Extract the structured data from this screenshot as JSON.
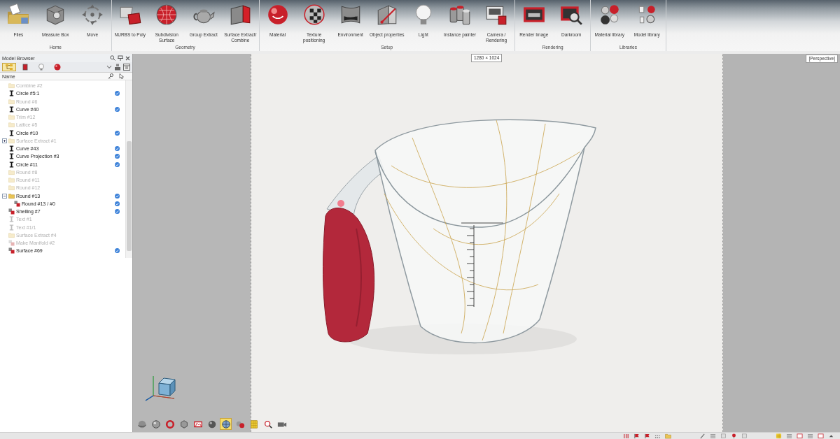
{
  "ribbon": {
    "groups": [
      {
        "label": "Home",
        "buttons": [
          {
            "label": "Files",
            "kind": "folder"
          },
          {
            "label": "Measure Box",
            "kind": "box"
          },
          {
            "label": "Move",
            "kind": "move"
          }
        ]
      },
      {
        "label": "Geometry",
        "buttons": [
          {
            "label": "NURBS to Poly",
            "kind": "sheets"
          },
          {
            "label": "Subdivision\nSurface",
            "kind": "grid_sphere"
          },
          {
            "label": "Group Extract",
            "kind": "teapot"
          },
          {
            "label": "Surface Extract/\nCombine",
            "kind": "cube"
          }
        ]
      },
      {
        "label": "Setup",
        "buttons": [
          {
            "label": "Material",
            "kind": "sphere"
          },
          {
            "label": "Texture\npositioning",
            "kind": "checker"
          },
          {
            "label": "Environment",
            "kind": "panel"
          },
          {
            "label": "Object properties",
            "kind": "box_pencil"
          },
          {
            "label": "Light",
            "kind": "bulb"
          },
          {
            "label": "Instance painter",
            "kind": "cylinders"
          },
          {
            "label": "Camera /\nRendering",
            "kind": "frames"
          }
        ]
      },
      {
        "label": "Rendering",
        "buttons": [
          {
            "label": "Render Image",
            "kind": "picture"
          },
          {
            "label": "Darkroom",
            "kind": "darkroom"
          }
        ]
      },
      {
        "label": "Libraries",
        "buttons": [
          {
            "label": "Material library",
            "kind": "spheres"
          },
          {
            "label": "Model library",
            "kind": "shapes"
          }
        ]
      }
    ]
  },
  "model_browser": {
    "title": "Model Browser",
    "tabs": [
      {
        "kind": "tree",
        "selected": true
      },
      {
        "kind": "square",
        "selected": false
      },
      {
        "kind": "bulb",
        "selected": false
      },
      {
        "kind": "sphere",
        "selected": false
      }
    ],
    "column": "Name",
    "tree": [
      {
        "label": "Combine #2",
        "kind": "folder",
        "visible": false
      },
      {
        "label": "Circle #5:1",
        "kind": "curve",
        "visible": true
      },
      {
        "label": "Round #6",
        "kind": "folder",
        "visible": false
      },
      {
        "label": "Curve #40",
        "kind": "curve",
        "visible": true
      },
      {
        "label": "Trim #12",
        "kind": "folder",
        "visible": false
      },
      {
        "label": "Lattice #5",
        "kind": "folder",
        "visible": false
      },
      {
        "label": "Circle #10",
        "kind": "curve",
        "visible": true
      },
      {
        "label": "Surface Extract #1",
        "kind": "folder",
        "visible": false,
        "expanded": false
      },
      {
        "label": "Curve #43",
        "kind": "curve",
        "visible": true
      },
      {
        "label": "Curve Projection #3",
        "kind": "curve",
        "visible": true
      },
      {
        "label": "Circle #11",
        "kind": "curve",
        "visible": true
      },
      {
        "label": "Round #8",
        "kind": "folder",
        "visible": false
      },
      {
        "label": "Round #11",
        "kind": "folder",
        "visible": false
      },
      {
        "label": "Round #12",
        "kind": "folder",
        "visible": false
      },
      {
        "label": "Round #13",
        "kind": "folder",
        "visible": true,
        "expanded": true,
        "children": [
          {
            "label": "Round #13 / #0",
            "kind": "solid",
            "visible": true
          }
        ]
      },
      {
        "label": "Shelling #7",
        "kind": "solid",
        "visible": true
      },
      {
        "label": "Text #1",
        "kind": "curve",
        "visible": false
      },
      {
        "label": "Text #1/1",
        "kind": "curve",
        "visible": false
      },
      {
        "label": "Surface Extract #4",
        "kind": "folder",
        "visible": false
      },
      {
        "label": "Make Manifold #2",
        "kind": "solid",
        "visible": false
      },
      {
        "label": "Surface #69",
        "kind": "solid",
        "visible": true
      }
    ]
  },
  "viewport": {
    "size_label": "1280 × 1024",
    "projection_label": "[Perspective]",
    "toolbar": [
      {
        "kind": "orbit",
        "selected": false
      },
      {
        "kind": "sphere",
        "selected": false
      },
      {
        "kind": "torus",
        "selected": false
      },
      {
        "kind": "cube",
        "selected": false
      },
      {
        "kind": "frame",
        "selected": false
      },
      {
        "kind": "ball",
        "selected": false
      },
      {
        "kind": "globe",
        "selected": true
      },
      {
        "kind": "spheres",
        "selected": false
      },
      {
        "kind": "grid",
        "selected": false
      },
      {
        "kind": "zoom",
        "selected": false
      },
      {
        "kind": "camera",
        "selected": false
      }
    ]
  }
}
